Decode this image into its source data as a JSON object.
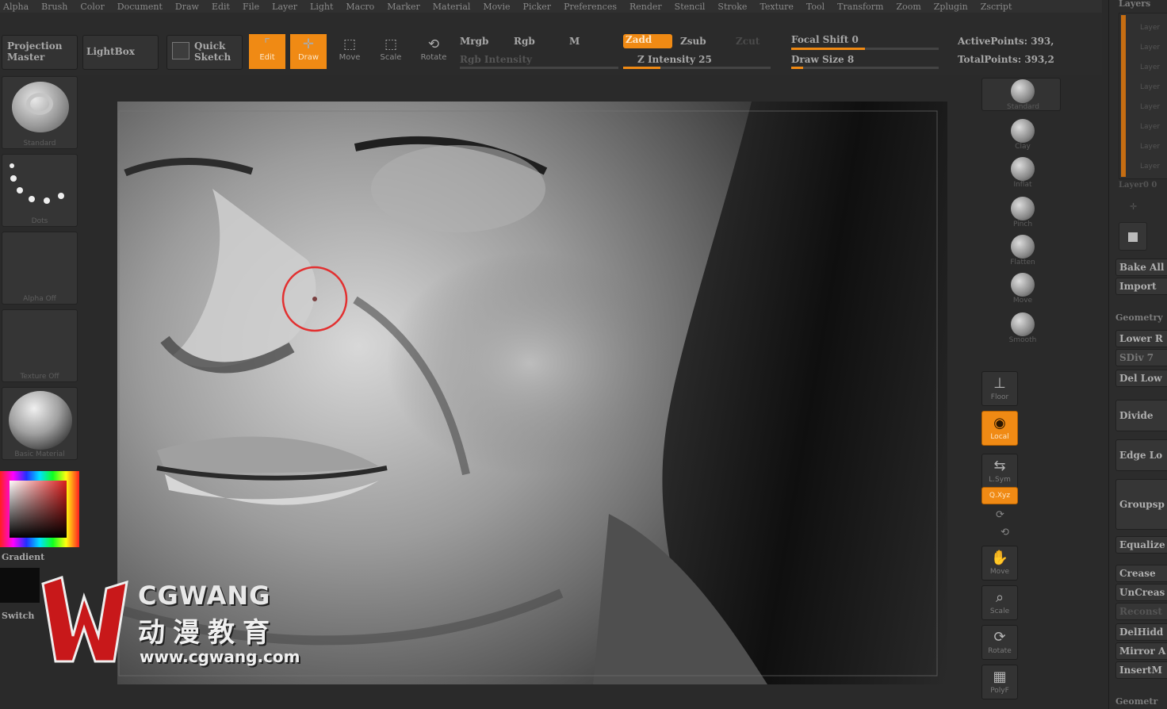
{
  "menu": [
    "Alpha",
    "Brush",
    "Color",
    "Document",
    "Draw",
    "Edit",
    "File",
    "Layer",
    "Light",
    "Macro",
    "Marker",
    "Material",
    "Movie",
    "Picker",
    "Preferences",
    "Render",
    "Stencil",
    "Stroke",
    "Texture",
    "Tool",
    "Transform",
    "Zoom",
    "Zplugin",
    "Zscript"
  ],
  "toolbar": {
    "projection_master": [
      "Projection",
      "Master"
    ],
    "lightbox": "LightBox",
    "quick_sketch": [
      "Quick",
      "Sketch"
    ],
    "tools": [
      {
        "label": "Edit",
        "icon": "edit-icon",
        "active": true
      },
      {
        "label": "Draw",
        "icon": "draw-icon",
        "active": true
      },
      {
        "label": "Move",
        "icon": "move-icon",
        "active": false
      },
      {
        "label": "Scale",
        "icon": "scale-icon",
        "active": false
      },
      {
        "label": "Rotate",
        "icon": "rotate-icon",
        "active": false
      }
    ],
    "mrgb": "Mrgb",
    "rgb": "Rgb",
    "m": "M",
    "rgb_intensity": "Rgb Intensity",
    "zadd": "Zadd",
    "zsub": "Zsub",
    "zcut": "Zcut",
    "z_intensity": "Z Intensity 25",
    "focal_shift": "Focal Shift 0",
    "draw_size": "Draw Size 8",
    "active_points": "ActivePoints: 393,",
    "total_points": "TotalPoints: 393,2",
    "z_intensity_level": 0.25,
    "focal_shift_level": 0.5,
    "draw_size_level": 0.08
  },
  "left_shelf": {
    "brush": "Standard",
    "stroke": "Dots",
    "alpha": "Alpha Off",
    "texture": "Texture Off",
    "material": "Basic Material",
    "gradient": "Gradient",
    "switch": "Switch"
  },
  "right_strip": {
    "brushes": [
      "Standard",
      "Clay",
      "Inflat",
      "Pinch",
      "Flatten",
      "Move",
      "Smooth"
    ],
    "floor": "Floor",
    "local": "Local",
    "lsym": "L.Sym",
    "xyz": "Q.Xyz",
    "move": "Move",
    "scale": "Scale",
    "rotate": "Rotate",
    "polyf": "PolyF"
  },
  "right_panel": {
    "layers_header": "Layers",
    "layers_items": [
      "Layer",
      "Layer",
      "Layer",
      "Layer",
      "Layer",
      "Layer",
      "Layer",
      "Layer"
    ],
    "layer_name": "Layer0 0",
    "bake_all": "Bake All",
    "import": "Import",
    "geometry_header": "Geometry",
    "lower_res": "Lower R",
    "sdiv": "SDiv 7",
    "del_lower": "Del Low",
    "divide": "Divide",
    "edge_loop": "Edge Lo",
    "groups_split": "Groupsp",
    "equalize": "Equalize",
    "crease": "Crease",
    "uncrease": "UnCreas",
    "reconstruct": "Reconst",
    "del_hidden": "DelHidd",
    "mirror": "Mirror A",
    "insert_mesh": "InsertM",
    "geometry_footer": "Geometr"
  },
  "watermark": {
    "brand": "CGWANG",
    "chinese": "动漫教育",
    "url": "www.cgwang.com"
  },
  "colors": {
    "accent": "#f08a14",
    "cursor_ring": "#e23030",
    "bg": "#2a2a2a"
  }
}
